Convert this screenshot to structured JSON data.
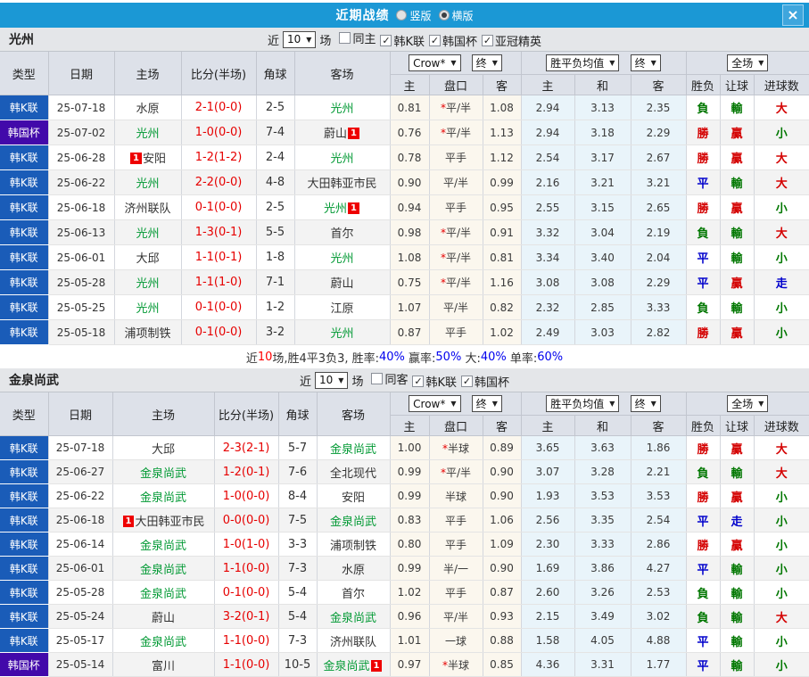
{
  "title_bar": {
    "title": "近期战绩",
    "options": [
      {
        "label": "竖版",
        "selected": false
      },
      {
        "label": "横版",
        "selected": true
      }
    ]
  },
  "icons": {
    "dropdown_arrow": "▼",
    "close": "×",
    "check": "✓"
  },
  "table_header": {
    "type": "类型",
    "date": "日期",
    "home": "主场",
    "score": "比分(半场)",
    "corner": "角球",
    "away": "客场",
    "sub": [
      "主",
      "盘口",
      "客",
      "主",
      "和",
      "客",
      "胜负",
      "让球",
      "进球数"
    ],
    "selects": {
      "bookmaker": "Crow*",
      "final1": "终",
      "avg": "胜平负均值",
      "final2": "终",
      "scope": "全场"
    }
  },
  "league_colors": {
    "韩K联": "#1a5cb8",
    "韩国杯": "#4209aa"
  },
  "result_colors": {
    "勝": "#d40000",
    "贏": "#d40000",
    "大": "#d40000",
    "平": "#0000cc",
    "走": "#0000cc",
    "負": "#007700",
    "輸": "#007700",
    "小": "#007700"
  },
  "sections": [
    {
      "team": "光州",
      "near_label": "近",
      "games_count": "10",
      "games_label": "场",
      "filters": [
        {
          "label": "同主",
          "checked": false
        },
        {
          "label": "韩K联",
          "checked": true
        },
        {
          "label": "韩国杯",
          "checked": true
        },
        {
          "label": "亚冠精英",
          "checked": true
        }
      ],
      "rows": [
        {
          "league": "韩K联",
          "date": "25-07-18",
          "home": "水原",
          "home_badge": "",
          "home_focus": false,
          "score": "2-1(0-0)",
          "corner": "2-5",
          "away": "光州",
          "away_badge": "",
          "away_focus": true,
          "o1": "0.81",
          "hcp": "*平/半",
          "o2": "1.08",
          "a1": "2.94",
          "a2": "3.13",
          "a3": "2.35",
          "res": "負",
          "let": "輸",
          "goal": "大"
        },
        {
          "league": "韩国杯",
          "date": "25-07-02",
          "home": "光州",
          "home_badge": "",
          "home_focus": true,
          "score": "1-0(0-0)",
          "corner": "7-4",
          "away": "蔚山",
          "away_badge": "1",
          "away_focus": false,
          "o1": "0.76",
          "hcp": "*平/半",
          "o2": "1.13",
          "a1": "2.94",
          "a2": "3.18",
          "a3": "2.29",
          "res": "勝",
          "let": "贏",
          "goal": "小"
        },
        {
          "league": "韩K联",
          "date": "25-06-28",
          "home": "安阳",
          "home_badge": "1",
          "home_focus": false,
          "score": "1-2(1-2)",
          "corner": "2-4",
          "away": "光州",
          "away_badge": "",
          "away_focus": true,
          "o1": "0.78",
          "hcp": "平手",
          "o2": "1.12",
          "a1": "2.54",
          "a2": "3.17",
          "a3": "2.67",
          "res": "勝",
          "let": "贏",
          "goal": "大"
        },
        {
          "league": "韩K联",
          "date": "25-06-22",
          "home": "光州",
          "home_badge": "",
          "home_focus": true,
          "score": "2-2(0-0)",
          "corner": "4-8",
          "away": "大田韩亚市民",
          "away_badge": "",
          "away_focus": false,
          "o1": "0.90",
          "hcp": "平/半",
          "o2": "0.99",
          "a1": "2.16",
          "a2": "3.21",
          "a3": "3.21",
          "res": "平",
          "let": "輸",
          "goal": "大"
        },
        {
          "league": "韩K联",
          "date": "25-06-18",
          "home": "济州联队",
          "home_badge": "",
          "home_focus": false,
          "score": "0-1(0-0)",
          "corner": "2-5",
          "away": "光州",
          "away_badge": "1",
          "away_focus": true,
          "o1": "0.94",
          "hcp": "平手",
          "o2": "0.95",
          "a1": "2.55",
          "a2": "3.15",
          "a3": "2.65",
          "res": "勝",
          "let": "贏",
          "goal": "小"
        },
        {
          "league": "韩K联",
          "date": "25-06-13",
          "home": "光州",
          "home_badge": "",
          "home_focus": true,
          "score": "1-3(0-1)",
          "corner": "5-5",
          "away": "首尔",
          "away_badge": "",
          "away_focus": false,
          "o1": "0.98",
          "hcp": "*平/半",
          "o2": "0.91",
          "a1": "3.32",
          "a2": "3.04",
          "a3": "2.19",
          "res": "負",
          "let": "輸",
          "goal": "大"
        },
        {
          "league": "韩K联",
          "date": "25-06-01",
          "home": "大邱",
          "home_badge": "",
          "home_focus": false,
          "score": "1-1(0-1)",
          "corner": "1-8",
          "away": "光州",
          "away_badge": "",
          "away_focus": true,
          "o1": "1.08",
          "hcp": "*平/半",
          "o2": "0.81",
          "a1": "3.34",
          "a2": "3.40",
          "a3": "2.04",
          "res": "平",
          "let": "輸",
          "goal": "小"
        },
        {
          "league": "韩K联",
          "date": "25-05-28",
          "home": "光州",
          "home_badge": "",
          "home_focus": true,
          "score": "1-1(1-0)",
          "corner": "7-1",
          "away": "蔚山",
          "away_badge": "",
          "away_focus": false,
          "o1": "0.75",
          "hcp": "*平/半",
          "o2": "1.16",
          "a1": "3.08",
          "a2": "3.08",
          "a3": "2.29",
          "res": "平",
          "let": "贏",
          "goal": "走"
        },
        {
          "league": "韩K联",
          "date": "25-05-25",
          "home": "光州",
          "home_badge": "",
          "home_focus": true,
          "score": "0-1(0-0)",
          "corner": "1-2",
          "away": "江原",
          "away_badge": "",
          "away_focus": false,
          "o1": "1.07",
          "hcp": "平/半",
          "o2": "0.82",
          "a1": "2.32",
          "a2": "2.85",
          "a3": "3.33",
          "res": "負",
          "let": "輸",
          "goal": "小"
        },
        {
          "league": "韩K联",
          "date": "25-05-18",
          "home": "浦项制铁",
          "home_badge": "",
          "home_focus": false,
          "score": "0-1(0-0)",
          "corner": "3-2",
          "away": "光州",
          "away_badge": "",
          "away_focus": true,
          "o1": "0.87",
          "hcp": "平手",
          "o2": "1.02",
          "a1": "2.49",
          "a2": "3.03",
          "a3": "2.82",
          "res": "勝",
          "let": "贏",
          "goal": "小"
        }
      ],
      "summary": [
        {
          "text": "近",
          "color": "#333333"
        },
        {
          "text": "10",
          "color": "#ff0000"
        },
        {
          "text": "场,胜4平3负3, 胜率:",
          "color": "#333333"
        },
        {
          "text": "40%",
          "color": "#0000ee"
        },
        {
          "text": " 赢率:",
          "color": "#333333"
        },
        {
          "text": "50%",
          "color": "#0000ee"
        },
        {
          "text": " 大:",
          "color": "#333333"
        },
        {
          "text": "40%",
          "color": "#0000ee"
        },
        {
          "text": " 单率:",
          "color": "#333333"
        },
        {
          "text": "60%",
          "color": "#0000ee"
        }
      ]
    },
    {
      "team": "金泉尚武",
      "near_label": "近",
      "games_count": "10",
      "games_label": "场",
      "filters": [
        {
          "label": "同客",
          "checked": false
        },
        {
          "label": "韩K联",
          "checked": true
        },
        {
          "label": "韩国杯",
          "checked": true
        }
      ],
      "rows": [
        {
          "league": "韩K联",
          "date": "25-07-18",
          "home": "大邱",
          "home_badge": "",
          "home_focus": false,
          "score": "2-3(2-1)",
          "corner": "5-7",
          "away": "金泉尚武",
          "away_badge": "",
          "away_focus": true,
          "o1": "1.00",
          "hcp": "*半球",
          "o2": "0.89",
          "a1": "3.65",
          "a2": "3.63",
          "a3": "1.86",
          "res": "勝",
          "let": "贏",
          "goal": "大"
        },
        {
          "league": "韩K联",
          "date": "25-06-27",
          "home": "金泉尚武",
          "home_badge": "",
          "home_focus": true,
          "score": "1-2(0-1)",
          "corner": "7-6",
          "away": "全北现代",
          "away_badge": "",
          "away_focus": false,
          "o1": "0.99",
          "hcp": "*平/半",
          "o2": "0.90",
          "a1": "3.07",
          "a2": "3.28",
          "a3": "2.21",
          "res": "負",
          "let": "輸",
          "goal": "大"
        },
        {
          "league": "韩K联",
          "date": "25-06-22",
          "home": "金泉尚武",
          "home_badge": "",
          "home_focus": true,
          "score": "1-0(0-0)",
          "corner": "8-4",
          "away": "安阳",
          "away_badge": "",
          "away_focus": false,
          "o1": "0.99",
          "hcp": "半球",
          "o2": "0.90",
          "a1": "1.93",
          "a2": "3.53",
          "a3": "3.53",
          "res": "勝",
          "let": "贏",
          "goal": "小"
        },
        {
          "league": "韩K联",
          "date": "25-06-18",
          "home": "大田韩亚市民",
          "home_badge": "1",
          "home_focus": false,
          "score": "0-0(0-0)",
          "corner": "7-5",
          "away": "金泉尚武",
          "away_badge": "",
          "away_focus": true,
          "o1": "0.83",
          "hcp": "平手",
          "o2": "1.06",
          "a1": "2.56",
          "a2": "3.35",
          "a3": "2.54",
          "res": "平",
          "let": "走",
          "goal": "小"
        },
        {
          "league": "韩K联",
          "date": "25-06-14",
          "home": "金泉尚武",
          "home_badge": "",
          "home_focus": true,
          "score": "1-0(1-0)",
          "corner": "3-3",
          "away": "浦项制铁",
          "away_badge": "",
          "away_focus": false,
          "o1": "0.80",
          "hcp": "平手",
          "o2": "1.09",
          "a1": "2.30",
          "a2": "3.33",
          "a3": "2.86",
          "res": "勝",
          "let": "贏",
          "goal": "小"
        },
        {
          "league": "韩K联",
          "date": "25-06-01",
          "home": "金泉尚武",
          "home_badge": "",
          "home_focus": true,
          "score": "1-1(0-0)",
          "corner": "7-3",
          "away": "水原",
          "away_badge": "",
          "away_focus": false,
          "o1": "0.99",
          "hcp": "半/一",
          "o2": "0.90",
          "a1": "1.69",
          "a2": "3.86",
          "a3": "4.27",
          "res": "平",
          "let": "輸",
          "goal": "小"
        },
        {
          "league": "韩K联",
          "date": "25-05-28",
          "home": "金泉尚武",
          "home_badge": "",
          "home_focus": true,
          "score": "0-1(0-0)",
          "corner": "5-4",
          "away": "首尔",
          "away_badge": "",
          "away_focus": false,
          "o1": "1.02",
          "hcp": "平手",
          "o2": "0.87",
          "a1": "2.60",
          "a2": "3.26",
          "a3": "2.53",
          "res": "負",
          "let": "輸",
          "goal": "小"
        },
        {
          "league": "韩K联",
          "date": "25-05-24",
          "home": "蔚山",
          "home_badge": "",
          "home_focus": false,
          "score": "3-2(0-1)",
          "corner": "5-4",
          "away": "金泉尚武",
          "away_badge": "",
          "away_focus": true,
          "o1": "0.96",
          "hcp": "平/半",
          "o2": "0.93",
          "a1": "2.15",
          "a2": "3.49",
          "a3": "3.02",
          "res": "負",
          "let": "輸",
          "goal": "大"
        },
        {
          "league": "韩K联",
          "date": "25-05-17",
          "home": "金泉尚武",
          "home_badge": "",
          "home_focus": true,
          "score": "1-1(0-0)",
          "corner": "7-3",
          "away": "济州联队",
          "away_badge": "",
          "away_focus": false,
          "o1": "1.01",
          "hcp": "一球",
          "o2": "0.88",
          "a1": "1.58",
          "a2": "4.05",
          "a3": "4.88",
          "res": "平",
          "let": "輸",
          "goal": "小"
        },
        {
          "league": "韩国杯",
          "date": "25-05-14",
          "home": "富川",
          "home_badge": "",
          "home_focus": false,
          "score": "1-1(0-0)",
          "corner": "10-5",
          "away": "金泉尚武",
          "away_badge": "1",
          "away_focus": true,
          "o1": "0.97",
          "hcp": "*半球",
          "o2": "0.85",
          "a1": "4.36",
          "a2": "3.31",
          "a3": "1.77",
          "res": "平",
          "let": "輸",
          "goal": "小"
        }
      ],
      "summary": []
    }
  ]
}
